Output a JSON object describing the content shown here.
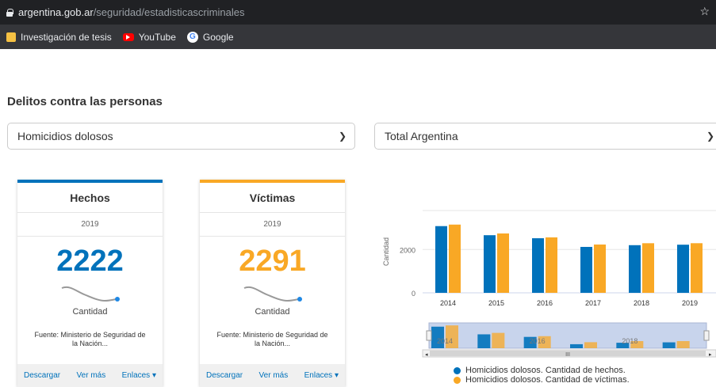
{
  "browser": {
    "url_host": "argentina.gob.ar",
    "url_path": "/seguridad/estadisticascriminales",
    "bookmarks": [
      {
        "label": "Investigación de tesis",
        "icon": "folder-icon"
      },
      {
        "label": "YouTube",
        "icon": "youtube-icon"
      },
      {
        "label": "Google",
        "icon": "google-icon"
      }
    ]
  },
  "page": {
    "section_title": "Delitos contra las personas",
    "select_crime": "Homicidios dolosos",
    "select_region": "Total Argentina"
  },
  "cards": {
    "hechos": {
      "title": "Hechos",
      "year": "2019",
      "value": "2222",
      "unit": "Cantidad",
      "source": "Fuente: Ministerio de Seguridad de la Nación...",
      "color": "#0072bb",
      "actions": {
        "download": "Descargar",
        "more": "Ver más",
        "links": "Enlaces ▾"
      }
    },
    "victimas": {
      "title": "Víctimas",
      "year": "2019",
      "value": "2291",
      "unit": "Cantidad",
      "source": "Fuente: Ministerio de Seguridad de la Nación...",
      "color": "#f9a825",
      "actions": {
        "download": "Descargar",
        "more": "Ver más",
        "links": "Enlaces ▾"
      }
    }
  },
  "chart_data": {
    "type": "bar",
    "categories": [
      "2014",
      "2015",
      "2016",
      "2017",
      "2018",
      "2019"
    ],
    "ylabel": "Cantidad",
    "yticks": [
      "0",
      "2000"
    ],
    "ylim": [
      0,
      3800
    ],
    "grid": true,
    "series": [
      {
        "name": "Homicidios dolosos. Cantidad de hechos.",
        "color": "#0072bb",
        "values": [
          3080,
          2660,
          2520,
          2120,
          2200,
          2222
        ]
      },
      {
        "name": "Homicidios dolosos. Cantidad de víctimas.",
        "color": "#f9a825",
        "values": [
          3150,
          2740,
          2560,
          2230,
          2290,
          2291
        ]
      }
    ],
    "navigator_labels": [
      "2014",
      "2016",
      "2018"
    ]
  }
}
